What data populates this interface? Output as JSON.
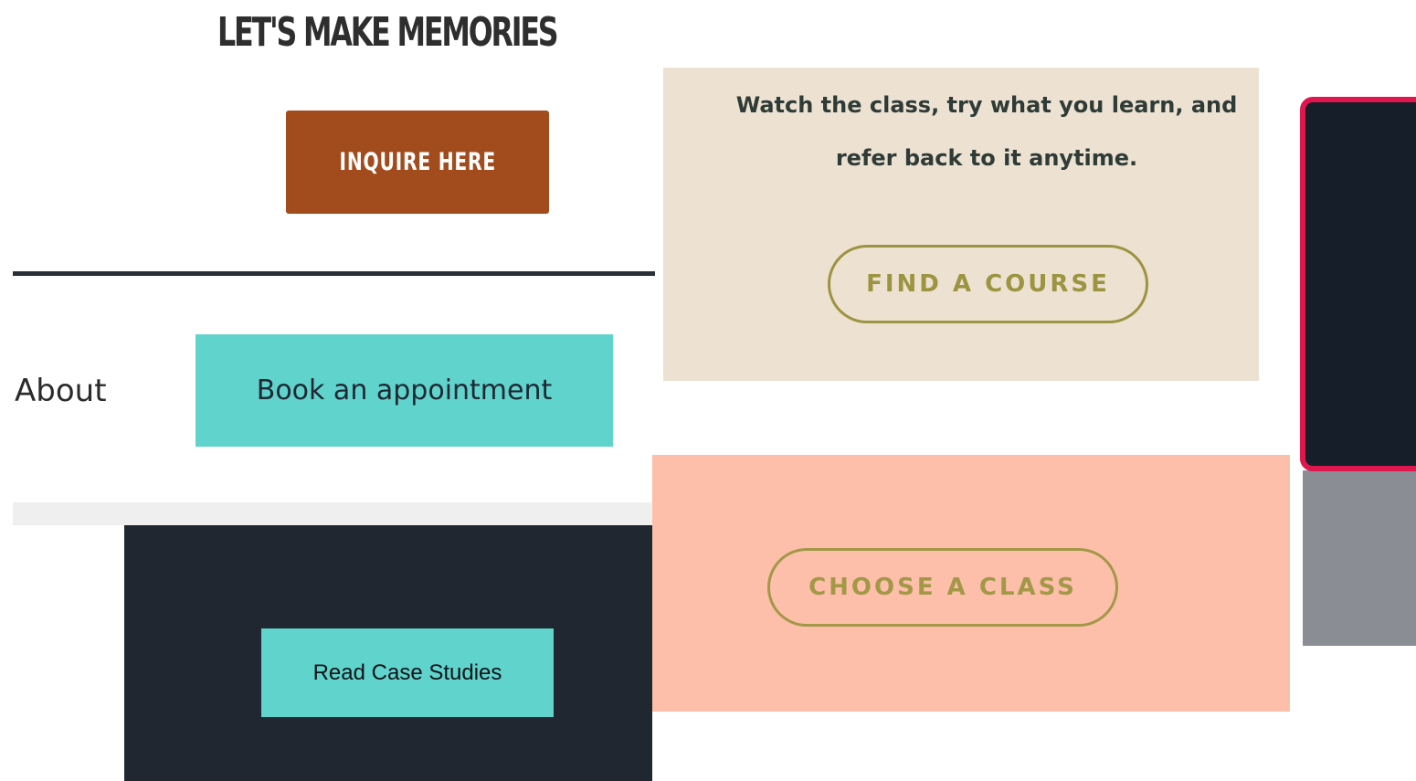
{
  "memories": {
    "heading": "LET'S MAKE MEMORIES",
    "inquire_label": "INQUIRE HERE",
    "accent": "#a24c1e"
  },
  "nav": {
    "about_label": "About",
    "book_label": "Book an appointment",
    "accent": "#61d3cd"
  },
  "case_studies": {
    "button_label": "Read Case Studies",
    "panel_color": "#212730"
  },
  "course": {
    "text": "Watch the class, try what you learn, and refer back to it anytime.",
    "button_label": "FIND A COURSE",
    "panel_color": "#ede1d2",
    "accent": "#9b9440"
  },
  "class": {
    "button_label": "CHOOSE A CLASS",
    "panel_color": "#fdbfaa",
    "accent": "#a39848"
  },
  "card": {
    "background": "#161f29",
    "border_color": "#e0164f"
  }
}
